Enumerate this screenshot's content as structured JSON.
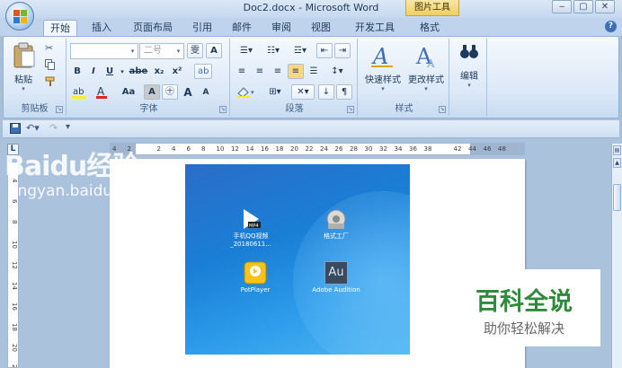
{
  "window": {
    "title": "Doc2.docx - Microsoft Word",
    "context_tab": "图片工具",
    "buttons": [
      "‒",
      "▢",
      "✕"
    ],
    "help": "?"
  },
  "tabs": [
    "开始",
    "插入",
    "页面布局",
    "引用",
    "邮件",
    "审阅",
    "视图",
    "开发工具",
    "格式"
  ],
  "ribbon": {
    "clipboard": {
      "label": "剪贴板",
      "paste": "粘贴"
    },
    "font": {
      "label": "字体",
      "font_size": "二号",
      "bold": "B",
      "italic": "I",
      "underline": "U",
      "strike": "abe",
      "subscript": "x₂",
      "superscript": "x²",
      "change_case": "Aa",
      "grow": "A",
      "shrink": "A",
      "clear": "A",
      "phonetic": "雯"
    },
    "paragraph": {
      "label": "段落"
    },
    "styles": {
      "label": "样式",
      "quick_styles": "快速样式",
      "change_styles": "更改样式"
    },
    "editing": {
      "label": "编辑"
    }
  },
  "ruler": {
    "h_ticks": [
      "4",
      "2",
      "",
      "2",
      "4",
      "6",
      "8",
      "10",
      "12",
      "14",
      "16",
      "18",
      "20",
      "22",
      "24",
      "26",
      "28",
      "30",
      "32",
      "34",
      "36",
      "38",
      "",
      "42",
      "44",
      "46",
      "48"
    ],
    "v_ticks": [
      "4",
      "6",
      "8",
      "10",
      "12",
      "14",
      "16",
      "18",
      "20",
      "22"
    ]
  },
  "desktop_icons": [
    {
      "name": "手机QQ视频_20180611...",
      "icon": "video-icon"
    },
    {
      "name": "格式工厂",
      "icon": "format-factory-icon"
    },
    {
      "name": "PotPlayer",
      "icon": "potplayer-icon"
    },
    {
      "name": "Adobe Audition",
      "icon": "audition-icon",
      "badge": "Au"
    }
  ],
  "watermark": {
    "logo": "Baidu经验",
    "url": "jingyan.baidu.com"
  },
  "overlay": {
    "title": "百科全说",
    "subtitle": "助你轻松解决"
  },
  "colors": {
    "ribbon": "#dbe8f7",
    "tab_bar": "#bfd3ec",
    "desktop": "#1a7fd6",
    "overlay_green": "#2f8a3c"
  }
}
